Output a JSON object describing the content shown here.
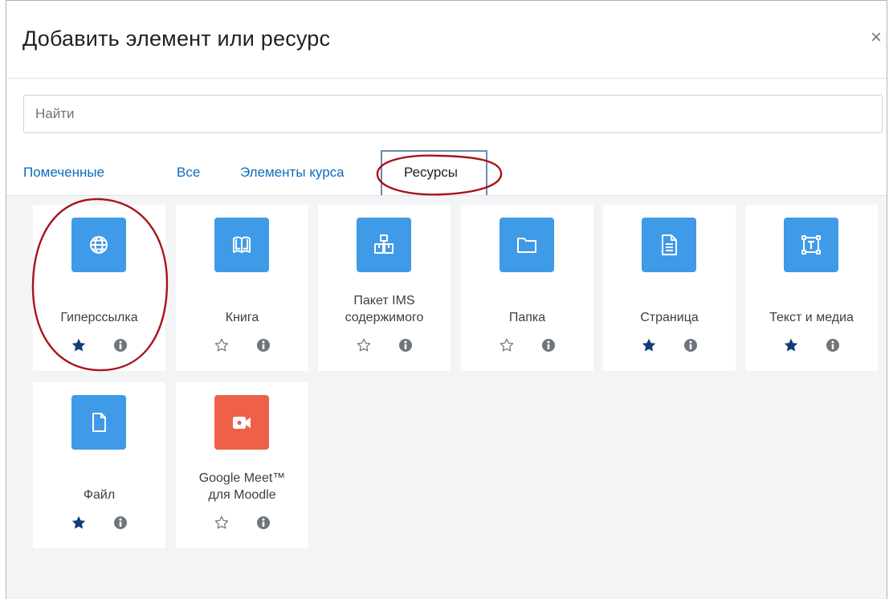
{
  "dialog": {
    "title": "Добавить элемент или ресурс",
    "close_label": "×"
  },
  "search": {
    "placeholder": "Найти"
  },
  "tabs": [
    {
      "label": "Помеченные"
    },
    {
      "label": "Все"
    },
    {
      "label": "Элементы курса"
    },
    {
      "label": "Ресурсы",
      "active": true
    }
  ],
  "items": [
    {
      "label": "Гиперссылка",
      "icon": "globe-icon",
      "starred": true
    },
    {
      "label": "Книга",
      "icon": "book-icon",
      "starred": false
    },
    {
      "label": "Пакет IMS содержимого",
      "label_line1": "Пакет IMS",
      "label_line2": "содержимого",
      "icon": "package-icon",
      "starred": false
    },
    {
      "label": "Папка",
      "icon": "folder-icon",
      "starred": false
    },
    {
      "label": "Страница",
      "icon": "page-icon",
      "starred": true
    },
    {
      "label": "Текст и медиа",
      "icon": "text-media-icon",
      "starred": true
    },
    {
      "label": "Файл",
      "icon": "file-icon",
      "starred": true
    },
    {
      "label": "Google Meet™ для Moodle",
      "label_line1": "Google Meet™",
      "label_line2": "для Moodle",
      "icon": "video-camera-icon",
      "starred": false
    }
  ],
  "colors": {
    "icon_blue": "#3f9ae8",
    "icon_red": "#ee6148",
    "link_blue": "#0f6cbf",
    "star_filled": "#0f3d7a",
    "annotation_red": "#a8141b",
    "annotation_box": "#6a8ab0"
  }
}
